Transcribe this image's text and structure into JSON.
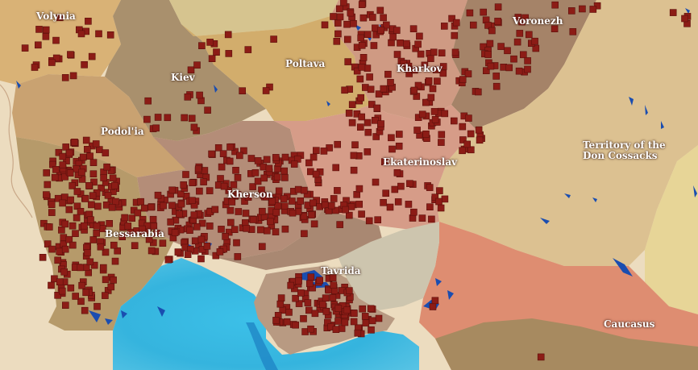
{
  "map": {
    "regions": [
      {
        "id": "volynia",
        "name": "Volynia"
      },
      {
        "id": "kiev",
        "name": "Kiev"
      },
      {
        "id": "poltava",
        "name": "Poltava"
      },
      {
        "id": "kharkov",
        "name": "Kharkov"
      },
      {
        "id": "voronezh",
        "name": "Voronezh"
      },
      {
        "id": "podolia",
        "name": "Podol'ia"
      },
      {
        "id": "kherson",
        "name": "Kherson"
      },
      {
        "id": "ekaterinoslav",
        "name": "Ekaterinoslav"
      },
      {
        "id": "don",
        "name": "Territory of the Don Cossacks"
      },
      {
        "id": "bessarabia",
        "name": "Bessarabia"
      },
      {
        "id": "tavrida",
        "name": "Tavrida"
      },
      {
        "id": "caucasus",
        "name": "Caucasus"
      }
    ],
    "colors": {
      "marker": "#8c1c16",
      "marker_border": "#5a0f0b",
      "sea": "#35b4de",
      "sea_deep": "#1f86c6",
      "azov_sea": "#c9c2ad",
      "land_background": "#ecdcbf",
      "water_features": "#1a4db0"
    },
    "marker_icon": "square-marker-icon"
  }
}
